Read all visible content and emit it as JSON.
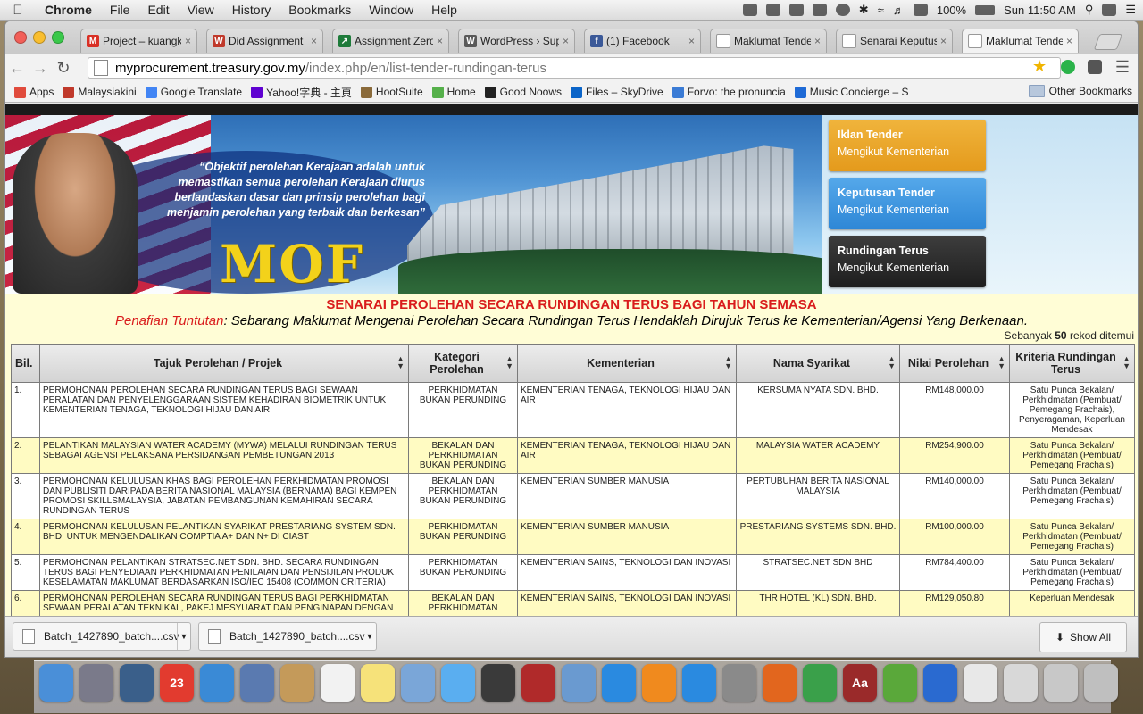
{
  "menubar": {
    "app": "Chrome",
    "items": [
      "File",
      "Edit",
      "View",
      "History",
      "Bookmarks",
      "Window",
      "Help"
    ],
    "battery": "100%",
    "clock": "Sun 11:50 AM"
  },
  "tabs": [
    {
      "title": "Project – kuangk",
      "color": "#d93025",
      "glyph": "M"
    },
    {
      "title": "Did Assignment",
      "color": "#c0392b",
      "glyph": "W"
    },
    {
      "title": "Assignment Zero",
      "color": "#1e7b3a",
      "glyph": "↗"
    },
    {
      "title": "WordPress › Supp",
      "color": "#5a5a5a",
      "glyph": "W"
    },
    {
      "title": "(1) Facebook",
      "color": "#3b5998",
      "glyph": "f"
    },
    {
      "title": "Maklumat Tende",
      "color": "#ffffff",
      "glyph": ""
    },
    {
      "title": "Senarai Keputusa",
      "color": "#ffffff",
      "glyph": ""
    },
    {
      "title": "Maklumat Tende",
      "color": "#ffffff",
      "glyph": ""
    }
  ],
  "address": {
    "host": "myprocurement.treasury.gov.my",
    "path": "/index.php/en/list-tender-rundingan-terus"
  },
  "bookmarks": [
    {
      "label": "Apps",
      "color": "#e04b3c"
    },
    {
      "label": "Malaysiakini",
      "color": "#c0392b"
    },
    {
      "label": "Google Translate",
      "color": "#4285f4"
    },
    {
      "label": "Yahoo!字典 - 主頁",
      "color": "#5f01d1"
    },
    {
      "label": "HootSuite",
      "color": "#8a6a3a"
    },
    {
      "label": "Home",
      "color": "#55b04a"
    },
    {
      "label": "Good Noows",
      "color": "#222222"
    },
    {
      "label": "Files – SkyDrive",
      "color": "#0a64c8"
    },
    {
      "label": "Forvo: the pronuncia",
      "color": "#3a7bd5"
    },
    {
      "label": "Music Concierge – S",
      "color": "#1e6ad6"
    }
  ],
  "bookmarks_other": "Other Bookmarks",
  "banner": {
    "quote": "“Objektif perolehan Kerajaan adalah untuk memastikan semua perolehan Kerajaan diurus berlandaskan dasar dan prinsip perolehan bagi menjamin perolehan yang terbaik dan berkesan”",
    "logo": "MOF",
    "buttons": [
      {
        "title": "Iklan Tender",
        "sub": "Mengikut Kementerian"
      },
      {
        "title": "Keputusan Tender",
        "sub": "Mengikut Kementerian"
      },
      {
        "title": "Rundingan Terus",
        "sub": "Mengikut Kementerian"
      }
    ]
  },
  "content": {
    "title": "SENARAI PEROLEHAN SECARA RUNDINGAN TERUS BAGI TAHUN SEMASA",
    "disclaimer_label": "Penafian Tuntutan",
    "disclaimer_text": ": Sebarang Maklumat Mengenai Perolehan Secara Rundingan Terus Hendaklah Dirujuk Terus ke Kementerian/Agensi Yang Berkenaan.",
    "count_prefix": "Sebanyak",
    "count_value": "50",
    "count_suffix": "rekod ditemui"
  },
  "table": {
    "headers": [
      "Bil.",
      "Tajuk Perolehan / Projek",
      "Kategori Perolehan",
      "Kementerian",
      "Nama Syarikat",
      "Nilai Perolehan",
      "Kriteria Rundingan Terus"
    ],
    "rows": [
      [
        "1.",
        "PERMOHONAN PEROLEHAN SECARA RUNDINGAN TERUS BAGI SEWAAN PERALATAN DAN PENYELENGGARAAN SISTEM KEHADIRAN BIOMETRIK UNTUK KEMENTERIAN TENAGA, TEKNOLOGI HIJAU DAN AIR",
        "PERKHIDMATAN BUKAN PERUNDING",
        "KEMENTERIAN TENAGA, TEKNOLOGI HIJAU DAN AIR",
        "KERSUMA NYATA SDN. BHD.",
        "RM148,000.00",
        "Satu Punca Bekalan/ Perkhidmatan (Pembuat/ Pemegang Frachais), Penyeragaman, Keperluan Mendesak"
      ],
      [
        "2.",
        "PELANTIKAN MALAYSIAN WATER ACADEMY (MYWA) MELALUI RUNDINGAN TERUS SEBAGAI AGENSI PELAKSANA PERSIDANGAN PEMBETUNGAN 2013",
        "BEKALAN DAN PERKHIDMATAN BUKAN PERUNDING",
        "KEMENTERIAN TENAGA, TEKNOLOGI HIJAU DAN AIR",
        "MALAYSIA WATER ACADEMY",
        "RM254,900.00",
        "Satu Punca Bekalan/ Perkhidmatan (Pembuat/ Pemegang Frachais)"
      ],
      [
        "3.",
        "PERMOHONAN KELULUSAN KHAS BAGI PEROLEHAN PERKHIDMATAN PROMOSI DAN PUBLISITI DARIPADA BERITA NASIONAL MALAYSIA (BERNAMA) BAGI KEMPEN PROMOSI SKILLSMALAYSIA, JABATAN PEMBANGUNAN KEMAHIRAN SECARA RUNDINGAN TERUS",
        "BEKALAN DAN PERKHIDMATAN BUKAN PERUNDING",
        "KEMENTERIAN SUMBER MANUSIA",
        "PERTUBUHAN BERITA NASIONAL MALAYSIA",
        "RM140,000.00",
        "Satu Punca Bekalan/ Perkhidmatan (Pembuat/ Pemegang Frachais)"
      ],
      [
        "4.",
        "PERMOHONAN KELULUSAN PELANTIKAN SYARIKAT PRESTARIANG SYSTEM SDN. BHD. UNTUK MENGENDALIKAN COMPTIA A+ DAN N+ DI CIAST",
        "PERKHIDMATAN BUKAN PERUNDING",
        "KEMENTERIAN SUMBER MANUSIA",
        "PRESTARIANG SYSTEMS SDN. BHD.",
        "RM100,000.00",
        "Satu Punca Bekalan/ Perkhidmatan (Pembuat/ Pemegang Frachais)"
      ],
      [
        "5.",
        "PERMOHONAN PELANTIKAN STRATSEC.NET SDN. BHD. SECARA RUNDINGAN TERUS BAGI PENYEDIAAN PERKHIDMATAN PENILAIAN DAN PENSIJILAN PRODUK KESELAMATAN MAKLUMAT BERDASARKAN ISO/IEC 15408 (COMMON CRITERIA)",
        "PERKHIDMATAN BUKAN PERUNDING",
        "KEMENTERIAN SAINS, TEKNOLOGI DAN INOVASI",
        "STRATSEC.NET SDN BHD",
        "RM784,400.00",
        "Satu Punca Bekalan/ Perkhidmatan (Pembuat/ Pemegang Frachais)"
      ],
      [
        "6.",
        "PERMOHONAN PEROLEHAN SECARA RUNDINGAN TERUS BAGI PERKHIDMATAN SEWAAN PERALATAN TEKNIKAL, PAKEJ MESYUARAT DAN PENGINAPAN DENGAN",
        "BEKALAN DAN PERKHIDMATAN",
        "KEMENTERIAN SAINS, TEKNOLOGI DAN INOVASI",
        "THR HOTEL (KL) SDN. BHD.",
        "RM129,050.80",
        "Keperluan Mendesak"
      ]
    ]
  },
  "downloads": [
    {
      "name": "Batch_1427890_batch....csv"
    },
    {
      "name": "Batch_1427890_batch....csv"
    }
  ],
  "show_all": "Show All",
  "dock": [
    {
      "name": "finder",
      "color": "#4a8fd8"
    },
    {
      "name": "launchpad",
      "color": "#7a7a8a"
    },
    {
      "name": "mission-control",
      "color": "#3a5f8a"
    },
    {
      "name": "calendar",
      "color": "#e23b2f",
      "glyph": "23"
    },
    {
      "name": "safari",
      "color": "#3a8ad6"
    },
    {
      "name": "mail-bird",
      "color": "#5a7ab0"
    },
    {
      "name": "contacts",
      "color": "#c49a5a"
    },
    {
      "name": "reminders",
      "color": "#f2f2f2"
    },
    {
      "name": "notes",
      "color": "#f6e27a"
    },
    {
      "name": "preview",
      "color": "#7aa6d8"
    },
    {
      "name": "messages",
      "color": "#5aaef0"
    },
    {
      "name": "facetime",
      "color": "#3a3a3a"
    },
    {
      "name": "photo-booth",
      "color": "#b02a2a"
    },
    {
      "name": "iphoto",
      "color": "#6a9ad0"
    },
    {
      "name": "itunes",
      "color": "#2a8ae0"
    },
    {
      "name": "ibooks",
      "color": "#f08a1e"
    },
    {
      "name": "app-store",
      "color": "#2a8ae0"
    },
    {
      "name": "system-preferences",
      "color": "#8a8a8a"
    },
    {
      "name": "firefox",
      "color": "#e2661e"
    },
    {
      "name": "chrome",
      "color": "#3aa04a"
    },
    {
      "name": "dictionary",
      "color": "#9a2a2a",
      "glyph": "Aa"
    },
    {
      "name": "evernote",
      "color": "#5aa83a"
    },
    {
      "name": "openoffice",
      "color": "#2a6ad0"
    },
    {
      "name": "textedit",
      "color": "#e8e8e8"
    },
    {
      "name": "downloads-stack",
      "color": "#d8d8d8"
    },
    {
      "name": "documents-stack",
      "color": "#c8c8c8"
    },
    {
      "name": "trash",
      "color": "#bfbfbf"
    }
  ]
}
